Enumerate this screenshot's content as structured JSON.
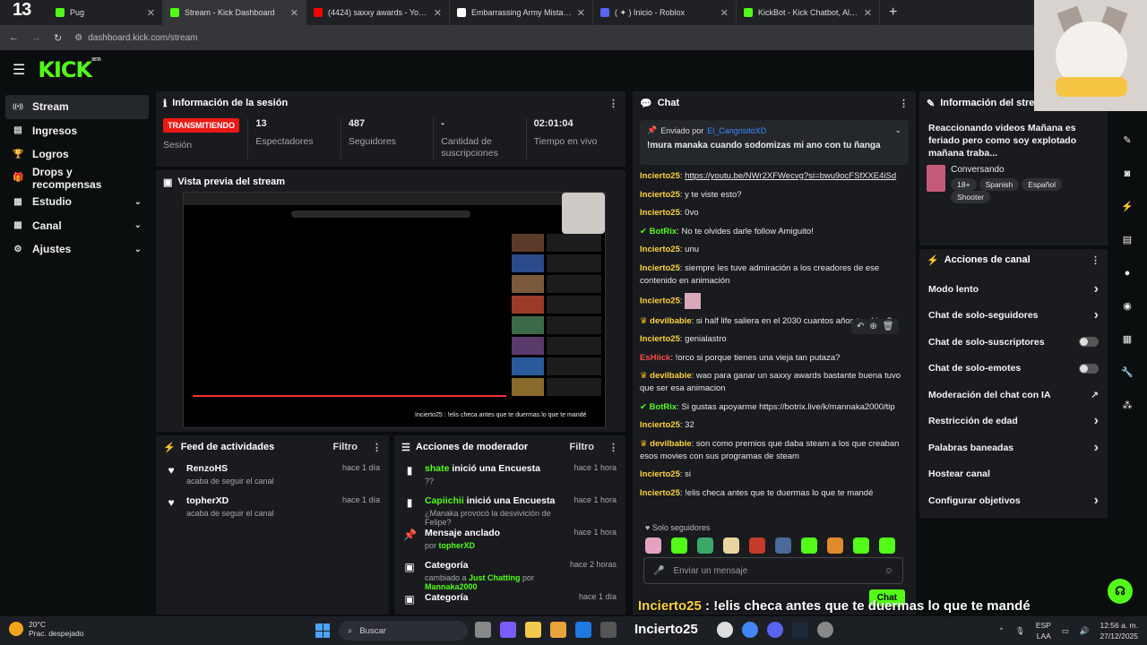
{
  "browser": {
    "tabs": [
      {
        "title": "Pug",
        "color": "#53fc18"
      },
      {
        "title": "Stream - Kick Dashboard",
        "color": "#53fc18"
      },
      {
        "title": "(4424) saxxy awards - YouTube",
        "color": "#ff0000"
      },
      {
        "title": "Embarrassing Army Mistakes in",
        "color": "#ffffff"
      },
      {
        "title": "( ✦ ) Inicio - Roblox",
        "color": "#5865f2"
      },
      {
        "title": "KickBot - Kick Chatbot, Alerts, T",
        "color": "#53fc18"
      }
    ],
    "tab_count_overlay": "13",
    "url": "dashboard.kick.com/stream"
  },
  "header": {
    "logo": "KICK",
    "logo_beta": "BETA"
  },
  "sidebar": {
    "items": [
      {
        "label": "Stream",
        "icon": "signal-icon"
      },
      {
        "label": "Ingresos",
        "icon": "money-icon"
      },
      {
        "label": "Logros",
        "icon": "trophy-icon"
      },
      {
        "label": "Drops y recompensas",
        "icon": "gift-icon"
      },
      {
        "label": "Estudio",
        "icon": "studio-icon"
      },
      {
        "label": "Canal",
        "icon": "channel-icon"
      },
      {
        "label": "Ajustes",
        "icon": "gear-icon"
      }
    ]
  },
  "session": {
    "title": "Información de la sesión",
    "live_badge": "TRANSMITIENDO",
    "session_label": "Sesión",
    "stats": [
      {
        "value": "13",
        "label": "Espectadores"
      },
      {
        "value": "487",
        "label": "Seguidores"
      },
      {
        "value": "-",
        "label": "Cantidad de suscripciones"
      },
      {
        "value": "02:01:04",
        "label": "Tiempo en vivo"
      }
    ]
  },
  "preview": {
    "title": "Vista previa del stream",
    "caption": "Incierto25 : !elis checa antes que te duermas lo que te mandé"
  },
  "activity": {
    "title": "Feed de actividades",
    "filter": "Filtro",
    "items": [
      {
        "name": "RenzoHS",
        "sub": "acaba de seguir el canal",
        "time": "hace 1 día"
      },
      {
        "name": "topherXD",
        "sub": "acaba de seguir el canal",
        "time": "hace 1 día"
      }
    ]
  },
  "modactions": {
    "title": "Acciones de moderador",
    "filter": "Filtro",
    "items": [
      {
        "user": "shate",
        "action": " inició una Encuesta",
        "sub": "??",
        "time": "hace 1 hora"
      },
      {
        "user": "Capiichii",
        "action": " inició una Encuesta",
        "sub": "¿Manaka provocó la desvivición de Felipe?",
        "time": "hace 1 hora"
      },
      {
        "user": "",
        "action": "Mensaje anclado",
        "sub_prefix": "por ",
        "sub_user": "topherXD",
        "time": "hace 1 hora"
      },
      {
        "user": "",
        "action": "Categoría",
        "sub_prefix": "cambiado a ",
        "sub_user": "Just Chatting",
        "sub_mid": " por ",
        "sub_user2": "Mannaka2000",
        "time": "hace 2 horas"
      },
      {
        "user": "",
        "action": "Categoría",
        "sub": "",
        "time": "hace 1 día"
      }
    ]
  },
  "chat": {
    "title": "Chat",
    "pinned": {
      "by_label": "Enviado por",
      "by_user": "El_CangrisitoXD",
      "text": "!mura manaka cuando sodomizas mi ano con tu ñanga"
    },
    "messages": [
      {
        "user": "Incierto25",
        "color": "#ffd23f",
        "text": "https://youtu.be/NWr2XFWecvg?si=bwu9ocFSfXXE4iSd",
        "link": true
      },
      {
        "user": "Incierto25",
        "color": "#ffd23f",
        "text": "y te viste esto?"
      },
      {
        "user": "Incierto25",
        "color": "#ffd23f",
        "text": "0vo"
      },
      {
        "user": "BotRix",
        "color": "#53fc18",
        "text": "No te olvides darle follow Amiguito!"
      },
      {
        "user": "Incierto25",
        "color": "#ffd23f",
        "text": "unu"
      },
      {
        "user": "Incierto25",
        "color": "#ffd23f",
        "text": "siempre les tuve admiración a los creadores de ese contenido en animación"
      },
      {
        "user": "Incierto25",
        "color": "#ffd23f",
        "text": ""
      },
      {
        "user": "devilbabie",
        "color": "#ffd23f",
        "text": "si half life saliera en el 2030 cuantos años tendrias?"
      },
      {
        "user": "Incierto25",
        "color": "#ffd23f",
        "text": "genialastro"
      },
      {
        "user": "EsHiick",
        "color": "#ff4a4a",
        "text": "!orco si porque tienes una vieja tan putaza?"
      },
      {
        "user": "devilbabie",
        "color": "#ffd23f",
        "text": "wao para ganar un saxxy awards bastante buena tuvo que ser esa animacion"
      },
      {
        "user": "BotRix",
        "color": "#53fc18",
        "text": "Si gustas apoyarme https://botrix.live/k/mannaka2000/tip"
      },
      {
        "user": "Incierto25",
        "color": "#ffd23f",
        "text": "32"
      },
      {
        "user": "devilbabie",
        "color": "#ffd23f",
        "text": "son como premios que daba steam a los que creaban esos movies con sus programas de steam"
      },
      {
        "user": "Incierto25",
        "color": "#ffd23f",
        "text": "si"
      },
      {
        "user": "Incierto25",
        "color": "#ffd23f",
        "text": "!elis checa antes que te duermas lo que te mandé"
      }
    ],
    "followers_only": "Solo seguidores",
    "input_placeholder": "Enviar un mensaje",
    "send": "Chat"
  },
  "overlay_text": {
    "user": "Incierto25",
    "text": " : !elis checa antes que te duermas lo que te mandé"
  },
  "streaminfo": {
    "title": "Información del stream",
    "text": "Reaccionando videos Mañana es feriado pero como soy explotado mañana traba...",
    "category": "Conversando",
    "tags": [
      "18+",
      "Spanish",
      "Español",
      "Shooter"
    ]
  },
  "channel_actions": {
    "title": "Acciones de canal",
    "items": [
      {
        "label": "Modo lento",
        "kind": "chevron"
      },
      {
        "label": "Chat de solo-seguidores",
        "kind": "chevron"
      },
      {
        "label": "Chat de solo-suscriptores",
        "kind": "toggle"
      },
      {
        "label": "Chat de solo-emotes",
        "kind": "toggle"
      },
      {
        "label": "Moderación del chat con IA",
        "kind": "external"
      },
      {
        "label": "Restricción de edad",
        "kind": "chevron"
      },
      {
        "label": "Palabras baneadas",
        "kind": "chevron"
      },
      {
        "label": "Hostear canal",
        "kind": "none"
      },
      {
        "label": "Configurar objetivos",
        "kind": "chevron"
      }
    ]
  },
  "taskbar": {
    "temp": "20°C",
    "weather": "Prac. despejado",
    "search": "Buscar",
    "lang": "ESP",
    "lang2": "LAA",
    "time": "12:56 a. m.",
    "date": "27/12/2025"
  }
}
